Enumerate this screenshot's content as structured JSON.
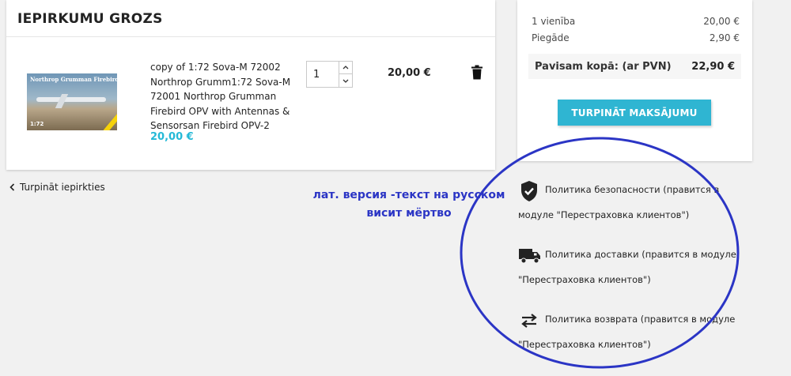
{
  "cart": {
    "title": "IEPIRKUMU GROZS",
    "product": {
      "image_brand": "Northrop Grumman Firebird",
      "image_scale": "1:72",
      "name": "copy of 1:72 Sova-M 72002 Northrop Grumm1:72 Sova-M 72001 Northrop Grumman Firebird OPV with Antennas & Sensorsan Firebird OPV-2",
      "price": "20,00 €",
      "quantity": "1",
      "line_total": "20,00 €"
    },
    "continue_label": "Turpināt iepirkties"
  },
  "summary": {
    "items_label": "1 vienība",
    "items_value": "20,00 €",
    "shipping_label": "Piegāde",
    "shipping_value": "2,90 €",
    "total_label": "Pavisam kopā: (ar PVN)",
    "total_value": "22,90 €",
    "checkout_label": "TURPINĀT MAKSĀJUMU"
  },
  "reassurance": [
    {
      "icon": "shield-check-icon",
      "line1": "Политика безопасности (правится в",
      "line2": "модуле \"Перестраховка клиентов\")"
    },
    {
      "icon": "truck-icon",
      "line1": "Политика доставки (правится в модуле",
      "line2": "\"Перестраховка клиентов\")"
    },
    {
      "icon": "swap-arrows-icon",
      "line1": "Политика возврата (правится в модуле",
      "line2": "\"Перестраховка клиентов\")"
    }
  ],
  "annotation": {
    "line1": "лат. версия -текст на русском",
    "line2": "висит мёртво",
    "color": "#2b35c5"
  },
  "colors": {
    "accent": "#2fb5d2",
    "price": "#24b9d7"
  }
}
